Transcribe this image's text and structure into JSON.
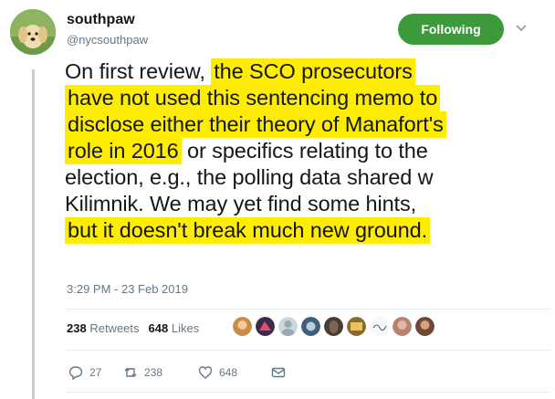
{
  "tweet": {
    "author_name": "southpaw",
    "author_handle": "@nycsouthpaw",
    "follow_label": "Following",
    "text_lines": [
      [
        {
          "t": "On first review, ",
          "h": false
        },
        {
          "t": "the SCO prosecutors",
          "h": true
        }
      ],
      [
        {
          "t": "have not used this sentencing memo to",
          "h": true
        }
      ],
      [
        {
          "t": "disclose either their theory of Manafort's",
          "h": true
        }
      ],
      [
        {
          "t": "role in 2016",
          "h": true
        },
        {
          "t": " or specifics relating to the",
          "h": false
        }
      ],
      [
        {
          "t": "election, e.g., the polling data shared w",
          "h": false
        }
      ],
      [
        {
          "t": "Kilimnik. We may yet find some hints,",
          "h": false
        }
      ],
      [
        {
          "t": "but it doesn't break much new ground.",
          "h": true
        }
      ]
    ],
    "timestamp": "3:29 PM - 23 Feb 2019",
    "retweets_count": "238",
    "retweets_label": "Retweets",
    "likes_count": "648",
    "likes_label": "Likes",
    "actions": {
      "reply_count": "27",
      "retweet_count": "238",
      "like_count": "648"
    }
  },
  "colors": {
    "highlight": "#ffed00",
    "follow_button": "#3d9a3b",
    "secondary_text": "#657786"
  }
}
